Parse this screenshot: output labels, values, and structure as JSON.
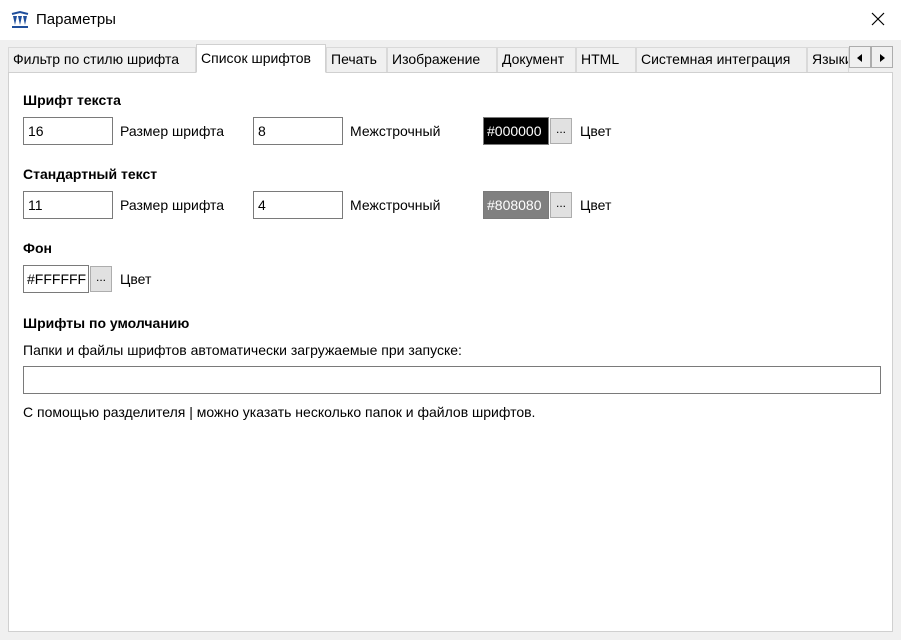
{
  "window": {
    "title": "Параметры",
    "icon": "app-logo-icon",
    "close_icon": "close-icon"
  },
  "tabs": [
    {
      "label": "Фильтр по стилю шрифта"
    },
    {
      "label": "Список шрифтов",
      "active": true
    },
    {
      "label": "Печать"
    },
    {
      "label": "Изображение"
    },
    {
      "label": "Документ"
    },
    {
      "label": "HTML"
    },
    {
      "label": "Системная интеграция"
    },
    {
      "label": "Языки"
    }
  ],
  "tab_scroll": {
    "left_icon": "arrow-left-icon",
    "right_icon": "arrow-right-icon"
  },
  "text_font": {
    "heading": "Шрифт текста",
    "size_value": "16",
    "size_label": "Размер шрифта",
    "spacing_value": "8",
    "spacing_label": "Межстрочный",
    "color_value": "#000000",
    "color_bg": "#000000",
    "color_fg": "#ffffff",
    "color_button": "...",
    "color_label": "Цвет"
  },
  "standard_text": {
    "heading": "Стандартный текст",
    "size_value": "11",
    "size_label": "Размер шрифта",
    "spacing_value": "4",
    "spacing_label": "Межстрочный",
    "color_value": "#808080",
    "color_bg": "#808080",
    "color_fg": "#ffffff",
    "color_button": "...",
    "color_label": "Цвет"
  },
  "background": {
    "heading": "Фон",
    "color_value": "#FFFFFF",
    "color_bg": "#ffffff",
    "color_fg": "#000000",
    "color_button": "...",
    "color_label": "Цвет"
  },
  "default_fonts": {
    "heading": "Шрифты по умолчанию",
    "description": "Папки и файлы шрифтов автоматически загружаемые при запуске:",
    "paths_value": "",
    "hint": "С помощью разделителя | можно указать несколько папок и файлов шрифтов."
  }
}
